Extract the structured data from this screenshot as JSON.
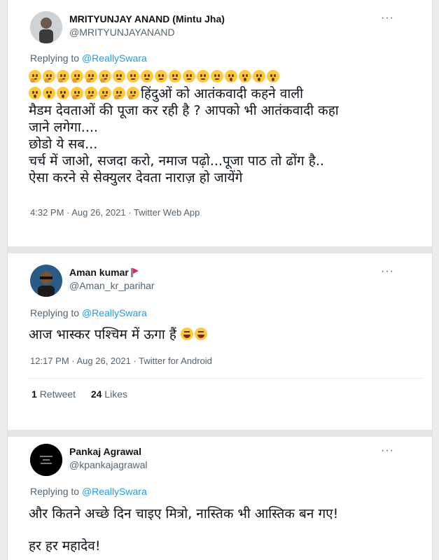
{
  "tweets": [
    {
      "author_name": "MRITYUNJAY ANAND (Mintu Jha)",
      "handle": "@MRITYUNJAYANAND",
      "more_label": "···",
      "replying_prefix": "Replying to",
      "replying_to": "@ReallySwara",
      "emoji_row1": [
        "think",
        "think",
        "think",
        "think",
        "think",
        "think",
        "neutral",
        "neutral",
        "neutral",
        "neutral",
        "neutral",
        "neutral",
        "neutral",
        "neutral",
        "open",
        "open",
        "open",
        "open"
      ],
      "emoji_row2": [
        "open",
        "open",
        "open",
        "think",
        "think",
        "think",
        "think",
        "think"
      ],
      "text_line1": "हिंदुओं को आतंकवादी कहने वाली",
      "text_lines": [
        "मैडम देवताओं की पूजा कर रही है ? आपको भी आतंकवादी कहा",
        "जाने लगेगा....",
        "छोडो ये सब...",
        "चर्च में जाओ, सजदा करो, नमाज पढ़ो...पूजा पाठ तो ढोंग है..",
        "ऐसा करने से सेक्युलर देवता नाराज़ हो जायेंगे"
      ],
      "timestamp": "4:32 PM · Aug 26, 2021 · Twitter Web App"
    },
    {
      "author_name": "Aman kumar",
      "handle": "@Aman_kr_parihar",
      "more_label": "···",
      "replying_prefix": "Replying to",
      "replying_to": "@ReallySwara",
      "text": "आज भास्कर पश्चिम में ऊगा हैं",
      "timestamp": "12:17 PM · Aug 26, 2021 · Twitter for Android",
      "retweets_count": "1",
      "retweets_label": "Retweet",
      "likes_count": "24",
      "likes_label": "Likes"
    },
    {
      "author_name": "Pankaj Agrawal",
      "handle": "@kpankajagrawal",
      "more_label": "···",
      "replying_prefix": "Replying to",
      "replying_to": "@ReallySwara",
      "text_line1": "और कितने अच्छे दिन चाइए मित्रो, नास्तिक भी आस्तिक बन गए!",
      "text_line2": "हर हर महादेव!"
    }
  ],
  "colors": {
    "link": "#1d9bf0",
    "secondary_text": "#536471",
    "primary_text": "#0f1419",
    "separator": "#e6e6e6",
    "emoji_face": "#ffc83d"
  }
}
